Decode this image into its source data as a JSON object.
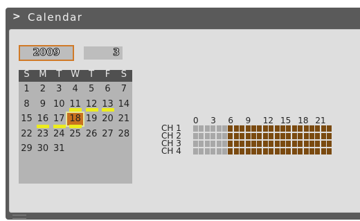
{
  "window": {
    "title": "Calendar",
    "title_icon": "chevron-right-icon"
  },
  "date": {
    "year": "2009",
    "month": "3"
  },
  "calendar": {
    "weekdays": [
      "S",
      "M",
      "T",
      "W",
      "T",
      "F",
      "S"
    ],
    "weeks": [
      [
        "1",
        "2",
        "3",
        "4",
        "5",
        "6",
        "7"
      ],
      [
        "8",
        "9",
        "10",
        "11",
        "12",
        "13",
        "14"
      ],
      [
        "15",
        "16",
        "17",
        "18",
        "19",
        "20",
        "21"
      ],
      [
        "22",
        "23",
        "24",
        "25",
        "26",
        "27",
        "28"
      ],
      [
        "29",
        "30",
        "31",
        "",
        "",
        "",
        ""
      ]
    ],
    "selected_day": "18",
    "days_with_recordings": [
      "11",
      "12",
      "13",
      "16",
      "17",
      "18"
    ]
  },
  "timeline": {
    "hour_labels": [
      "0",
      "3",
      "6",
      "9",
      "12",
      "15",
      "18",
      "21"
    ],
    "channels": [
      "CH 1",
      "CH 2",
      "CH 3",
      "CH 4"
    ],
    "recorded_hours": {
      "start": 6,
      "end": 24
    }
  },
  "colors": {
    "recorded": "#7a4a10",
    "empty": "#a8a8a8",
    "day_marker": "#ecec1e",
    "selected_day": "#c8721f",
    "accent_border": "#d07a28"
  }
}
